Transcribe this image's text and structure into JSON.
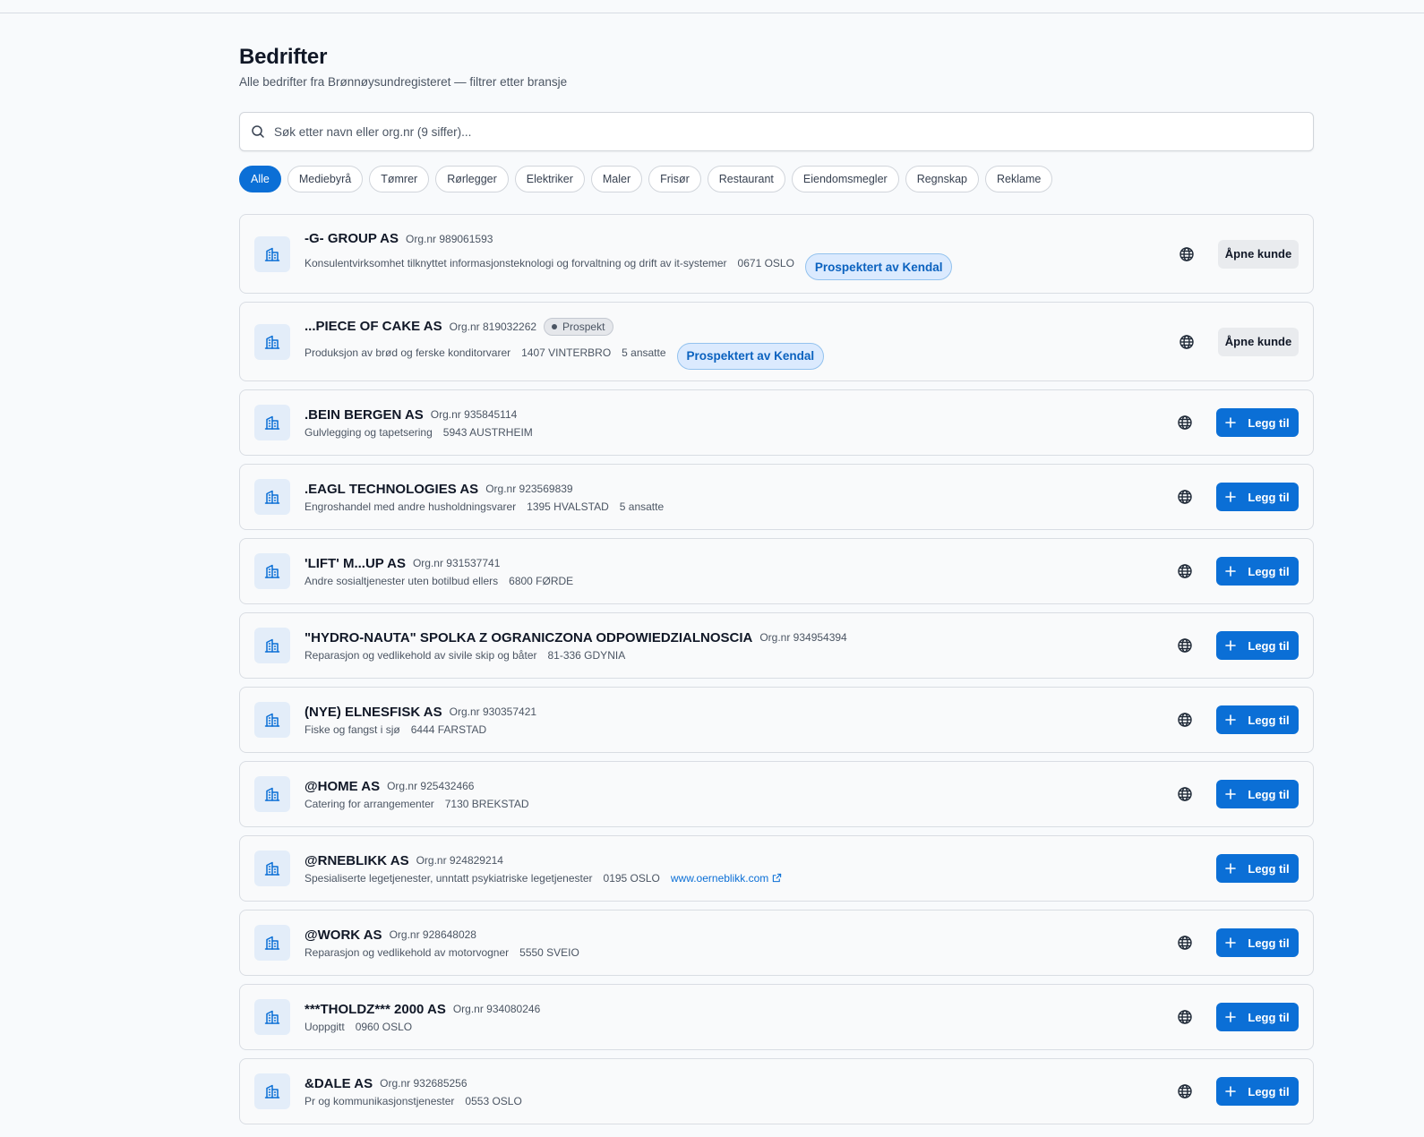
{
  "page": {
    "title": "Bedrifter",
    "subtitle": "Alle bedrifter fra Brønnøysundregisteret — filtrer etter bransje"
  },
  "search": {
    "placeholder": "Søk etter navn eller org.nr (9 siffer)...",
    "value": ""
  },
  "filters": [
    "Alle",
    "Mediebyrå",
    "Tømrer",
    "Rørlegger",
    "Elektriker",
    "Maler",
    "Frisør",
    "Restaurant",
    "Eiendomsmegler",
    "Regnskap",
    "Reklame"
  ],
  "active_filter": "Alle",
  "labels": {
    "open_customer": "Åpne kunde",
    "add": "Legg til",
    "prospected_by": "Prospektert av Kendal",
    "prospect_badge": "Prospekt"
  },
  "companies": [
    {
      "name": "-G- GROUP AS",
      "org": "Org.nr 989061593",
      "industry": "Konsulentvirksomhet tilknyttet informasjonsteknologi og forvaltning og drift av it-systemer",
      "location": "0671 OSLO",
      "employees": "",
      "website": "",
      "badge": "",
      "prospected": true,
      "action": "open",
      "globe": true
    },
    {
      "name": "...PIECE OF CAKE AS",
      "org": "Org.nr 819032262",
      "industry": "Produksjon av brød og ferske konditorvarer",
      "location": "1407 VINTERBRO",
      "employees": "5 ansatte",
      "website": "",
      "badge": "Prospekt",
      "prospected": true,
      "action": "open",
      "globe": true
    },
    {
      "name": ".BEIN BERGEN AS",
      "org": "Org.nr 935845114",
      "industry": "Gulvlegging og tapetsering",
      "location": "5943 AUSTRHEIM",
      "employees": "",
      "website": "",
      "badge": "",
      "prospected": false,
      "action": "add",
      "globe": true
    },
    {
      "name": ".EAGL TECHNOLOGIES AS",
      "org": "Org.nr 923569839",
      "industry": "Engroshandel med andre husholdningsvarer",
      "location": "1395 HVALSTAD",
      "employees": "5 ansatte",
      "website": "",
      "badge": "",
      "prospected": false,
      "action": "add",
      "globe": true
    },
    {
      "name": "'LIFT' M...UP AS",
      "org": "Org.nr 931537741",
      "industry": "Andre sosialtjenester uten botilbud ellers",
      "location": "6800 FØRDE",
      "employees": "",
      "website": "",
      "badge": "",
      "prospected": false,
      "action": "add",
      "globe": true
    },
    {
      "name": "\"HYDRO-NAUTA\" SPOLKA Z OGRANICZONA ODPOWIEDZIALNOSCIA",
      "org": "Org.nr 934954394",
      "industry": "Reparasjon og vedlikehold av sivile skip og båter",
      "location": "81-336 GDYNIA",
      "employees": "",
      "website": "",
      "badge": "",
      "prospected": false,
      "action": "add",
      "globe": true
    },
    {
      "name": "(NYE) ELNESFISK AS",
      "org": "Org.nr 930357421",
      "industry": "Fiske og fangst i sjø",
      "location": "6444 FARSTAD",
      "employees": "",
      "website": "",
      "badge": "",
      "prospected": false,
      "action": "add",
      "globe": true
    },
    {
      "name": "@HOME AS",
      "org": "Org.nr 925432466",
      "industry": "Catering for arrangementer",
      "location": "7130 BREKSTAD",
      "employees": "",
      "website": "",
      "badge": "",
      "prospected": false,
      "action": "add",
      "globe": true
    },
    {
      "name": "@RNEBLIKK AS",
      "org": "Org.nr 924829214",
      "industry": "Spesialiserte legetjenester, unntatt psykiatriske legetjenester",
      "location": "0195 OSLO",
      "employees": "",
      "website": "www.oerneblikk.com",
      "badge": "",
      "prospected": false,
      "action": "add",
      "globe": false
    },
    {
      "name": "@WORK AS",
      "org": "Org.nr 928648028",
      "industry": "Reparasjon og vedlikehold av motorvogner",
      "location": "5550 SVEIO",
      "employees": "",
      "website": "",
      "badge": "",
      "prospected": false,
      "action": "add",
      "globe": true
    },
    {
      "name": "***THOLDZ*** 2000 AS",
      "org": "Org.nr 934080246",
      "industry": "Uoppgitt",
      "location": "0960 OSLO",
      "employees": "",
      "website": "",
      "badge": "",
      "prospected": false,
      "action": "add",
      "globe": true
    },
    {
      "name": "&DALE AS",
      "org": "Org.nr 932685256",
      "industry": "Pr og kommunikasjonstjenester",
      "location": "0553 OSLO",
      "employees": "",
      "website": "",
      "badge": "",
      "prospected": false,
      "action": "add",
      "globe": true
    }
  ],
  "colors": {
    "primary": "#0b6fd6",
    "background": "#f8fafc",
    "pill_bg": "#dbeafe",
    "avatar_bg": "#e3edf9"
  },
  "icons": {
    "search": "search-icon",
    "avatar": "building-icon",
    "website": "globe-icon",
    "add": "plus-icon",
    "external": "external-link-icon"
  }
}
